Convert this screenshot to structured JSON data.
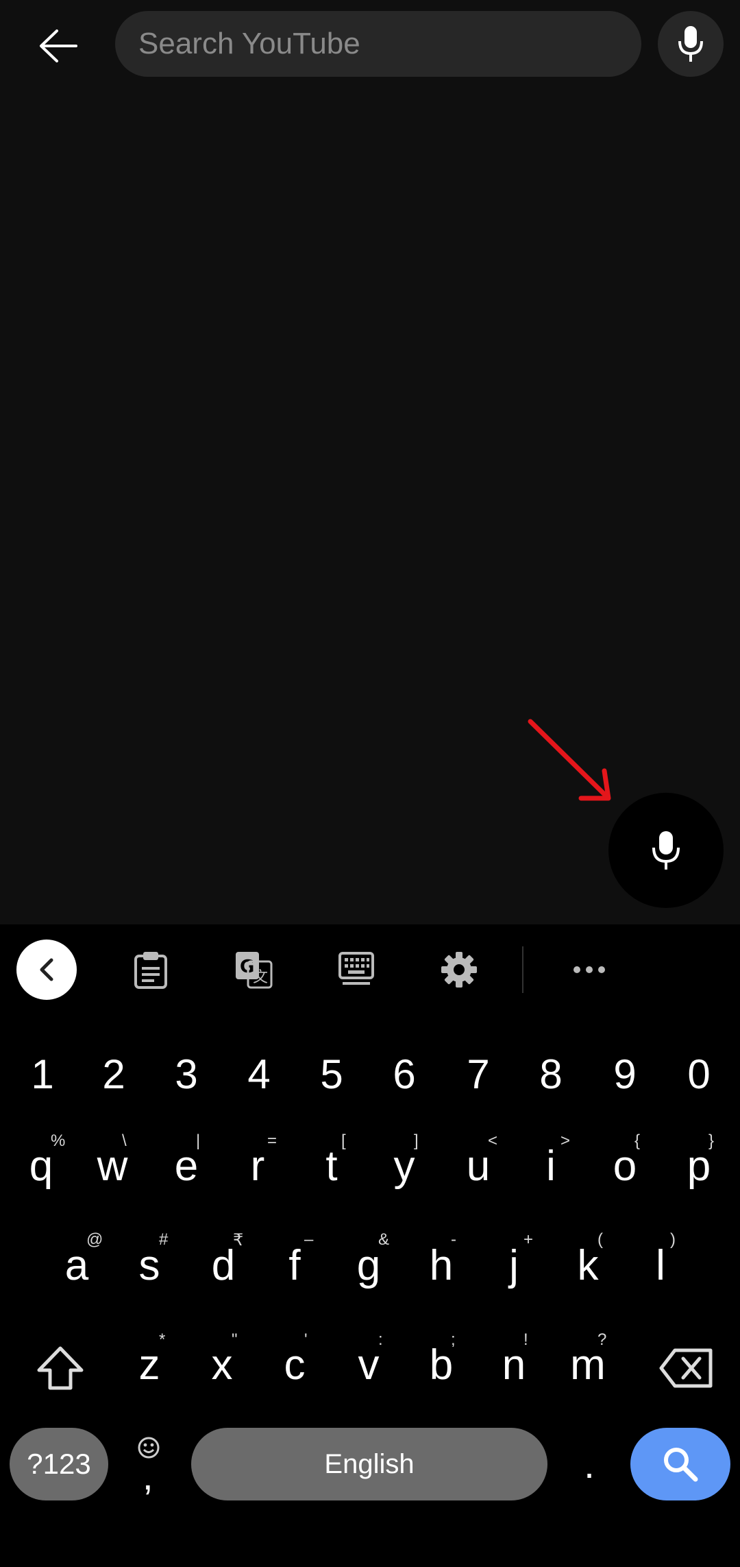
{
  "search": {
    "placeholder": "Search YouTube",
    "value": ""
  },
  "icons": {
    "back": "arrow-back-icon",
    "top_mic": "microphone-icon",
    "fab_mic": "microphone-icon",
    "annotation": "red-arrow-annotation"
  },
  "keyboard": {
    "toolbar": [
      "collapse-toolbar-icon",
      "clipboard-icon",
      "translate-icon",
      "keyboard-layout-icon",
      "settings-gear-icon",
      "more-options-icon"
    ],
    "digits": [
      "1",
      "2",
      "3",
      "4",
      "5",
      "6",
      "7",
      "8",
      "9",
      "0"
    ],
    "row1": [
      {
        "k": "q",
        "h": "%"
      },
      {
        "k": "w",
        "h": "\\"
      },
      {
        "k": "e",
        "h": "|"
      },
      {
        "k": "r",
        "h": "="
      },
      {
        "k": "t",
        "h": "["
      },
      {
        "k": "y",
        "h": "]"
      },
      {
        "k": "u",
        "h": "<"
      },
      {
        "k": "i",
        "h": ">"
      },
      {
        "k": "o",
        "h": "{"
      },
      {
        "k": "p",
        "h": "}"
      }
    ],
    "row2": [
      {
        "k": "a",
        "h": "@"
      },
      {
        "k": "s",
        "h": "#"
      },
      {
        "k": "d",
        "h": "₹"
      },
      {
        "k": "f",
        "h": "–"
      },
      {
        "k": "g",
        "h": "&"
      },
      {
        "k": "h",
        "h": "-"
      },
      {
        "k": "j",
        "h": "+"
      },
      {
        "k": "k",
        "h": "("
      },
      {
        "k": "l",
        "h": ")"
      }
    ],
    "row3": [
      {
        "k": "z",
        "h": "*"
      },
      {
        "k": "x",
        "h": "\""
      },
      {
        "k": "c",
        "h": "'"
      },
      {
        "k": "v",
        "h": ":"
      },
      {
        "k": "b",
        "h": ";"
      },
      {
        "k": "n",
        "h": "!"
      },
      {
        "k": "m",
        "h": "?"
      }
    ],
    "symbols_label": "?123",
    "comma_label": ",",
    "space_label": "English",
    "period_label": ".",
    "colors": {
      "accent": "#5e97f6",
      "key_gray": "#6b6b6b",
      "fab": "#000000",
      "arrow": "#e4161b"
    }
  }
}
